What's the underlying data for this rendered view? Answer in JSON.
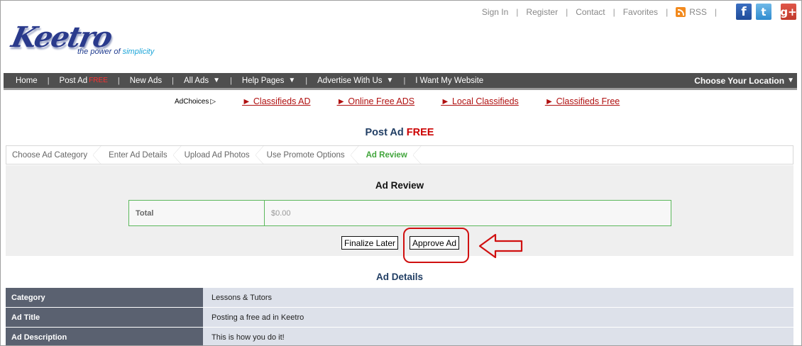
{
  "toplinks": {
    "sign_in": "Sign In",
    "register": "Register",
    "contact": "Contact",
    "favorites": "Favorites",
    "rss": "RSS",
    "sep": "|"
  },
  "social": {
    "facebook": "f",
    "twitter": "t",
    "google": "g+"
  },
  "logo": {
    "wordmark": "Keetro",
    "tagline_prefix": "the power of",
    "tagline_accent": "simplicity"
  },
  "nav": {
    "home": "Home",
    "post_ad": "Post Ad",
    "post_ad_badge": "FREE",
    "new_ads": "New Ads",
    "all_ads": "All Ads",
    "help_pages": "Help Pages",
    "advertise": "Advertise With Us",
    "website": "I Want My Website",
    "location": "Choose Your Location",
    "caret": "▼",
    "sep": "|"
  },
  "adrow": {
    "adchoices": "AdChoices",
    "links": [
      "► Classifieds AD",
      "► Online Free ADS",
      "► Local Classifieds",
      "► Classifieds Free"
    ]
  },
  "page": {
    "title": "Post Ad",
    "title_badge": "FREE"
  },
  "steps": [
    {
      "label": "Choose Ad Category"
    },
    {
      "label": "Enter Ad Details"
    },
    {
      "label": "Upload Ad Photos"
    },
    {
      "label": "Use Promote Options"
    },
    {
      "label": "Ad Review",
      "active": true
    }
  ],
  "review": {
    "title": "Ad Review",
    "total_label": "Total",
    "total_value": "$0.00",
    "finalize_later": "Finalize Later",
    "approve": "Approve Ad"
  },
  "details": {
    "title": "Ad Details",
    "rows": [
      {
        "label": "Category",
        "value": "Lessons & Tutors"
      },
      {
        "label": "Ad Title",
        "value": "Posting a free ad in Keetro"
      },
      {
        "label": "Ad Description",
        "value": "This is how you do it!"
      }
    ]
  },
  "colors": {
    "nav_bg": "#4f4f4f",
    "active_step": "#41a53b",
    "free_red": "#cc0000",
    "highlight": "#d01010",
    "detail_label_bg": "#5a6170",
    "detail_value_bg": "#dde1ea"
  }
}
